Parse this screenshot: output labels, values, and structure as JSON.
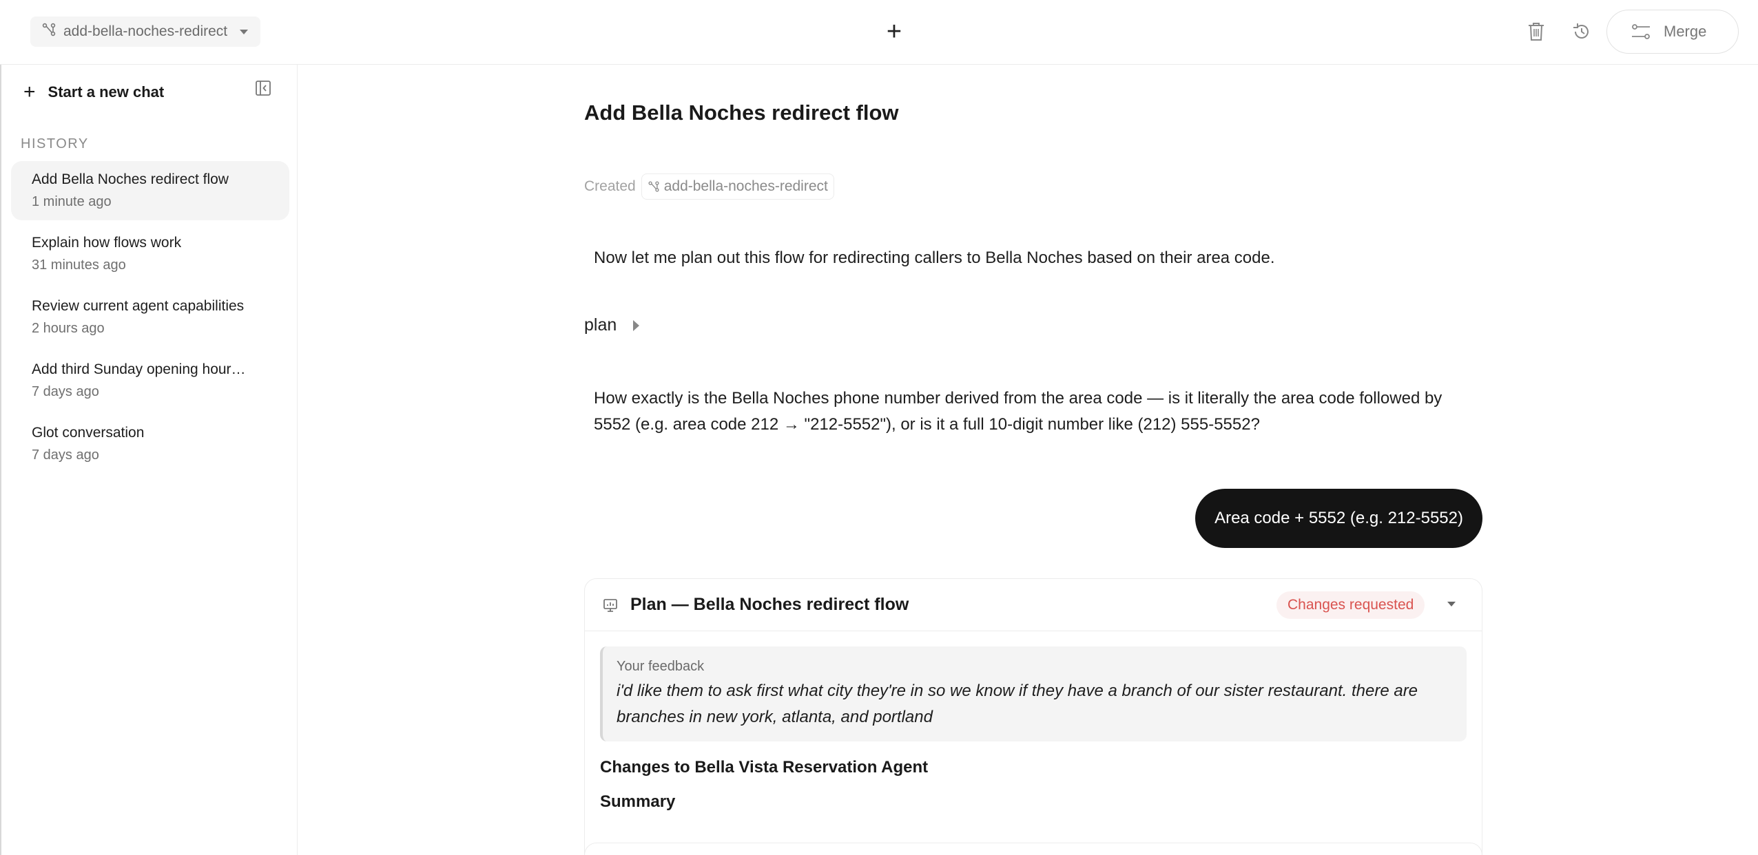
{
  "topbar": {
    "branch": "add-bella-noches-redirect",
    "new_tab_symbol": "+",
    "merge_label": "Merge"
  },
  "sidebar": {
    "new_chat_label": "Start a new chat",
    "history_title": "HISTORY",
    "items": [
      {
        "title": "Add Bella Noches redirect flow",
        "time": "1 minute ago"
      },
      {
        "title": "Explain how flows work",
        "time": "31 minutes ago"
      },
      {
        "title": "Review current agent capabilities",
        "time": "2 hours ago"
      },
      {
        "title": "Add third Sunday opening hour…",
        "time": "7 days ago"
      },
      {
        "title": "Glot conversation",
        "time": "7 days ago"
      }
    ]
  },
  "main": {
    "title": "Add Bella Noches redirect flow",
    "created_label": "Created",
    "created_branch": "add-bella-noches-redirect",
    "assistant_msg_1": "Now let me plan out this flow for redirecting callers to Bella Noches based on their area code.",
    "plan_toggle_label": "plan",
    "assistant_msg_2": "How exactly is the Bella Noches phone number derived from the area code — is it literally the area code followed by 5552 (e.g. area code 212 → \"212-5552\"), or is it a full 10-digit number like (212) 555-5552?",
    "user_msg": "Area code + 5552 (e.g. 212-5552)",
    "plan_card": {
      "title": "Plan — Bella Noches redirect flow",
      "status": "Changes requested",
      "status_color": "#d9534f",
      "feedback_label": "Your feedback",
      "feedback_text": "i'd like them to ask first what city they're in so we know if they have a branch of our sister restaurant. there are branches in new york, atlanta, and portland",
      "section_1": "Changes to Bella Vista Reservation Agent",
      "section_2": "Summary"
    }
  }
}
